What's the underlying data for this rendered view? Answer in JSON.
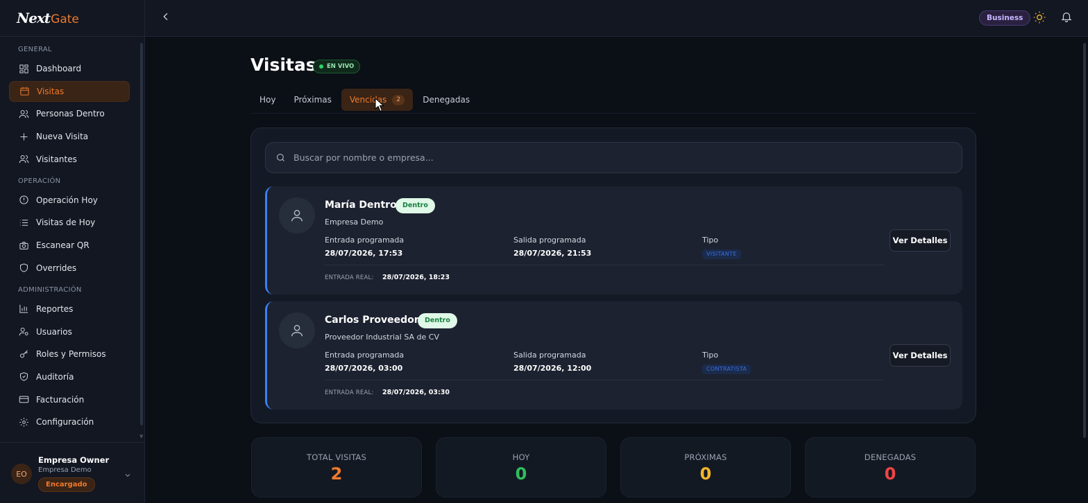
{
  "app": {
    "logo_first": "Next",
    "logo_second": "Gate"
  },
  "sidebar": {
    "sections": [
      {
        "title": "GENERAL",
        "items": [
          "Dashboard",
          "Visitas",
          "Personas Dentro",
          "Nueva Visita",
          "Visitantes"
        ]
      },
      {
        "title": "OPERACIÓN",
        "items": [
          "Operación Hoy",
          "Visitas de Hoy",
          "Escanear QR",
          "Overrides"
        ]
      },
      {
        "title": "ADMINISTRACIÓN",
        "items": [
          "Reportes",
          "Usuarios",
          "Roles y Permisos",
          "Auditoría",
          "Facturación",
          "Configuración"
        ]
      }
    ],
    "active_item": "Visitas",
    "user": {
      "initials": "EO",
      "name": "Empresa Owner",
      "company": "Empresa Demo",
      "role": "Encargado"
    }
  },
  "topbar": {
    "plan": "Business"
  },
  "page": {
    "title": "Visitas",
    "live_label": "EN VIVO",
    "tabs": [
      {
        "label": "Hoy"
      },
      {
        "label": "Próximas"
      },
      {
        "label": "Vencidas",
        "count": "2"
      },
      {
        "label": "Denegadas"
      }
    ],
    "active_tab": "Vencidas",
    "search": {
      "placeholder": "Buscar por nombre o empresa...",
      "value": ""
    }
  },
  "visit_labels": {
    "entrada": "Entrada programada",
    "salida": "Salida programada",
    "tipo": "Tipo",
    "entrada_real": "ENTRADA REAL:",
    "details_button": "Ver Detalles"
  },
  "visits": [
    {
      "name": "María Dentro",
      "status": "Dentro",
      "company": "Empresa Demo",
      "entrada": "28/07/2026, 17:53",
      "salida": "28/07/2026, 21:53",
      "tipo": "VISITANTE",
      "entrada_real": "28/07/2026, 18:23"
    },
    {
      "name": "Carlos Proveedor",
      "status": "Dentro",
      "company": "Proveedor Industrial SA de CV",
      "entrada": "28/07/2026, 03:00",
      "salida": "28/07/2026, 12:00",
      "tipo": "CONTRATISTA",
      "entrada_real": "28/07/2026, 03:30"
    }
  ],
  "stats": [
    {
      "label": "TOTAL VISITAS",
      "value": "2",
      "color": "#f07a2c"
    },
    {
      "label": "HOY",
      "value": "0",
      "color": "#2fbf5c"
    },
    {
      "label": "PRÓXIMAS",
      "value": "0",
      "color": "#f2b52c"
    },
    {
      "label": "DENEGADAS",
      "value": "0",
      "color": "#ef4444"
    }
  ],
  "colors": {
    "accent": "#f07a2c",
    "live": "#2fd16a",
    "card_border": "#3b82f6"
  },
  "icons": {
    "sidebar": [
      "dashboard-icon",
      "calendar-icon",
      "users-icon",
      "plus-icon",
      "users-icon",
      "alert-circle-icon",
      "list-icon",
      "camera-icon",
      "shield-icon",
      "bar-chart-icon",
      "user-cog-icon",
      "key-icon",
      "shield-check-icon",
      "credit-card-icon",
      "gear-icon"
    ]
  }
}
